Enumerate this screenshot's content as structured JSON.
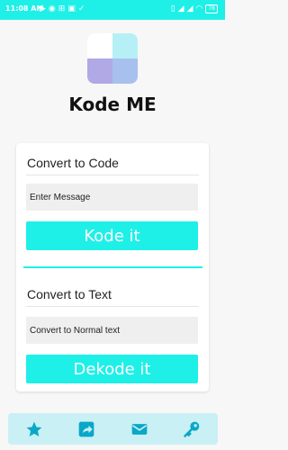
{
  "status": {
    "time": "11:08 AM",
    "battery": "78"
  },
  "app": {
    "title": "Kode ME"
  },
  "logo": {
    "colors": [
      "#ffffff",
      "#b6f0f6",
      "#b0a9e6",
      "#a8c0ee"
    ]
  },
  "encode": {
    "title": "Convert to Code",
    "placeholder": "Enter Message",
    "button_label": "Kode it"
  },
  "decode": {
    "title": "Convert to Text",
    "placeholder": "Convert to Normal text",
    "button_label": "Dekode it"
  },
  "theme": {
    "accent": "#1ef0e8",
    "nav_bg": "#c9f0f4",
    "nav_icon": "#0aa7c9"
  },
  "bottom_nav": [
    {
      "icon": "star-icon"
    },
    {
      "icon": "share-icon"
    },
    {
      "icon": "mail-icon"
    },
    {
      "icon": "key-icon"
    }
  ]
}
